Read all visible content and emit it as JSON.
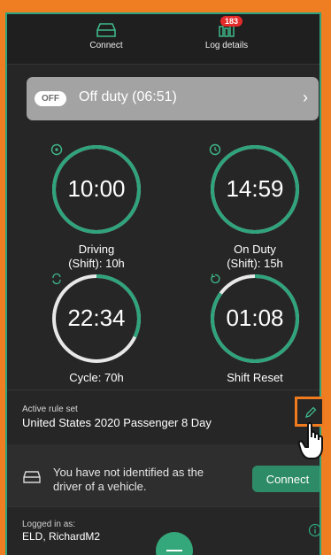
{
  "nav": {
    "connect_label": "Connect",
    "log_label": "Log details",
    "log_badge": "183"
  },
  "status": {
    "pill": "OFF",
    "text": "Off duty (06:51)"
  },
  "gauges": [
    {
      "value": "10:00",
      "label_line1": "Driving",
      "label_line2": "(Shift): 10h",
      "icon": "steering-wheel-icon",
      "progress": 1.0
    },
    {
      "value": "14:59",
      "label_line1": "On Duty",
      "label_line2": "(Shift): 15h",
      "icon": "clock-icon",
      "progress": 1.0
    },
    {
      "value": "22:34",
      "label_line1": "Cycle: 70h",
      "label_line2": "",
      "icon": "cycle-icon",
      "progress": 0.32
    },
    {
      "value": "01:08",
      "label_line1": "Shift Reset",
      "label_line2": "",
      "icon": "reset-icon",
      "progress": 0.85
    }
  ],
  "rule": {
    "caption": "Active rule set",
    "value": "United States 2020 Passenger 8 Day"
  },
  "vehicle": {
    "message": "You have not identified as the driver of a vehicle.",
    "connect_button": "Connect"
  },
  "logged": {
    "caption": "Logged in as:",
    "user": "ELD, RichardM2"
  },
  "colors": {
    "accent": "#2fa37c",
    "highlight": "#f07b1e",
    "badge": "#e52a2a"
  }
}
